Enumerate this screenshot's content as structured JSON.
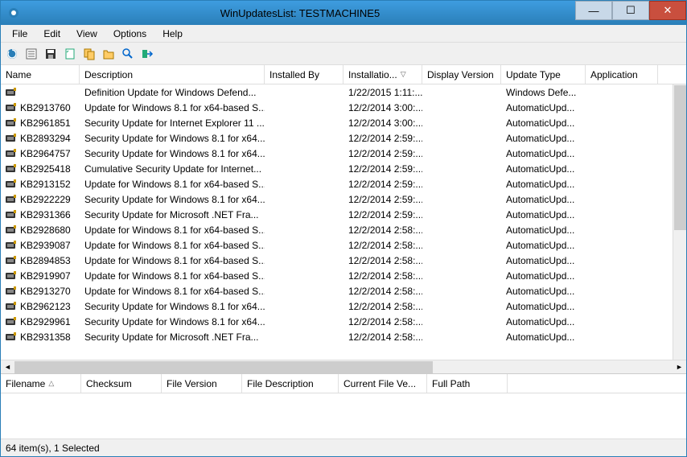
{
  "window": {
    "title": "WinUpdatesList:  TESTMACHINE5"
  },
  "menu": {
    "file": "File",
    "edit": "Edit",
    "view": "View",
    "options": "Options",
    "help": "Help"
  },
  "columns": {
    "name": "Name",
    "description": "Description",
    "installedBy": "Installed By",
    "installationDate": "Installatio...",
    "displayVersion": "Display Version",
    "updateType": "Update Type",
    "application": "Application"
  },
  "detailColumns": {
    "filename": "Filename",
    "checksum": "Checksum",
    "fileVersion": "File Version",
    "fileDescription": "File Description",
    "currentFileVersion": "Current File Ve...",
    "fullPath": "Full Path"
  },
  "rows": [
    {
      "name": "",
      "description": "Definition Update for Windows Defend...",
      "installedBy": "",
      "date": "1/22/2015 1:11:...",
      "displayVersion": "",
      "updateType": "Windows Defe...",
      "application": ""
    },
    {
      "name": "KB2913760",
      "description": "Update for Windows 8.1 for x64-based S...",
      "installedBy": "",
      "date": "12/2/2014 3:00:...",
      "displayVersion": "",
      "updateType": "AutomaticUpd...",
      "application": ""
    },
    {
      "name": "KB2961851",
      "description": "Security Update for Internet Explorer 11 ...",
      "installedBy": "",
      "date": "12/2/2014 3:00:...",
      "displayVersion": "",
      "updateType": "AutomaticUpd...",
      "application": ""
    },
    {
      "name": "KB2893294",
      "description": "Security Update for Windows 8.1 for x64...",
      "installedBy": "",
      "date": "12/2/2014 2:59:...",
      "displayVersion": "",
      "updateType": "AutomaticUpd...",
      "application": ""
    },
    {
      "name": "KB2964757",
      "description": "Security Update for Windows 8.1 for x64...",
      "installedBy": "",
      "date": "12/2/2014 2:59:...",
      "displayVersion": "",
      "updateType": "AutomaticUpd...",
      "application": ""
    },
    {
      "name": "KB2925418",
      "description": "Cumulative Security Update for Internet...",
      "installedBy": "",
      "date": "12/2/2014 2:59:...",
      "displayVersion": "",
      "updateType": "AutomaticUpd...",
      "application": ""
    },
    {
      "name": "KB2913152",
      "description": "Update for Windows 8.1 for x64-based S...",
      "installedBy": "",
      "date": "12/2/2014 2:59:...",
      "displayVersion": "",
      "updateType": "AutomaticUpd...",
      "application": ""
    },
    {
      "name": "KB2922229",
      "description": "Security Update for Windows 8.1 for x64...",
      "installedBy": "",
      "date": "12/2/2014 2:59:...",
      "displayVersion": "",
      "updateType": "AutomaticUpd...",
      "application": ""
    },
    {
      "name": "KB2931366",
      "description": "Security Update for Microsoft .NET Fra...",
      "installedBy": "",
      "date": "12/2/2014 2:59:...",
      "displayVersion": "",
      "updateType": "AutomaticUpd...",
      "application": ""
    },
    {
      "name": "KB2928680",
      "description": "Update for Windows 8.1 for x64-based S...",
      "installedBy": "",
      "date": "12/2/2014 2:58:...",
      "displayVersion": "",
      "updateType": "AutomaticUpd...",
      "application": ""
    },
    {
      "name": "KB2939087",
      "description": "Update for Windows 8.1 for x64-based S...",
      "installedBy": "",
      "date": "12/2/2014 2:58:...",
      "displayVersion": "",
      "updateType": "AutomaticUpd...",
      "application": ""
    },
    {
      "name": "KB2894853",
      "description": "Update for Windows 8.1 for x64-based S...",
      "installedBy": "",
      "date": "12/2/2014 2:58:...",
      "displayVersion": "",
      "updateType": "AutomaticUpd...",
      "application": ""
    },
    {
      "name": "KB2919907",
      "description": "Update for Windows 8.1 for x64-based S...",
      "installedBy": "",
      "date": "12/2/2014 2:58:...",
      "displayVersion": "",
      "updateType": "AutomaticUpd...",
      "application": ""
    },
    {
      "name": "KB2913270",
      "description": "Update for Windows 8.1 for x64-based S...",
      "installedBy": "",
      "date": "12/2/2014 2:58:...",
      "displayVersion": "",
      "updateType": "AutomaticUpd...",
      "application": ""
    },
    {
      "name": "KB2962123",
      "description": "Security Update for Windows 8.1 for x64...",
      "installedBy": "",
      "date": "12/2/2014 2:58:...",
      "displayVersion": "",
      "updateType": "AutomaticUpd...",
      "application": ""
    },
    {
      "name": "KB2929961",
      "description": "Security Update for Windows 8.1 for x64...",
      "installedBy": "",
      "date": "12/2/2014 2:58:...",
      "displayVersion": "",
      "updateType": "AutomaticUpd...",
      "application": ""
    },
    {
      "name": "KB2931358",
      "description": "Security Update for Microsoft .NET Fra...",
      "installedBy": "",
      "date": "12/2/2014 2:58:...",
      "displayVersion": "",
      "updateType": "AutomaticUpd...",
      "application": ""
    }
  ],
  "status": "64 item(s), 1 Selected"
}
